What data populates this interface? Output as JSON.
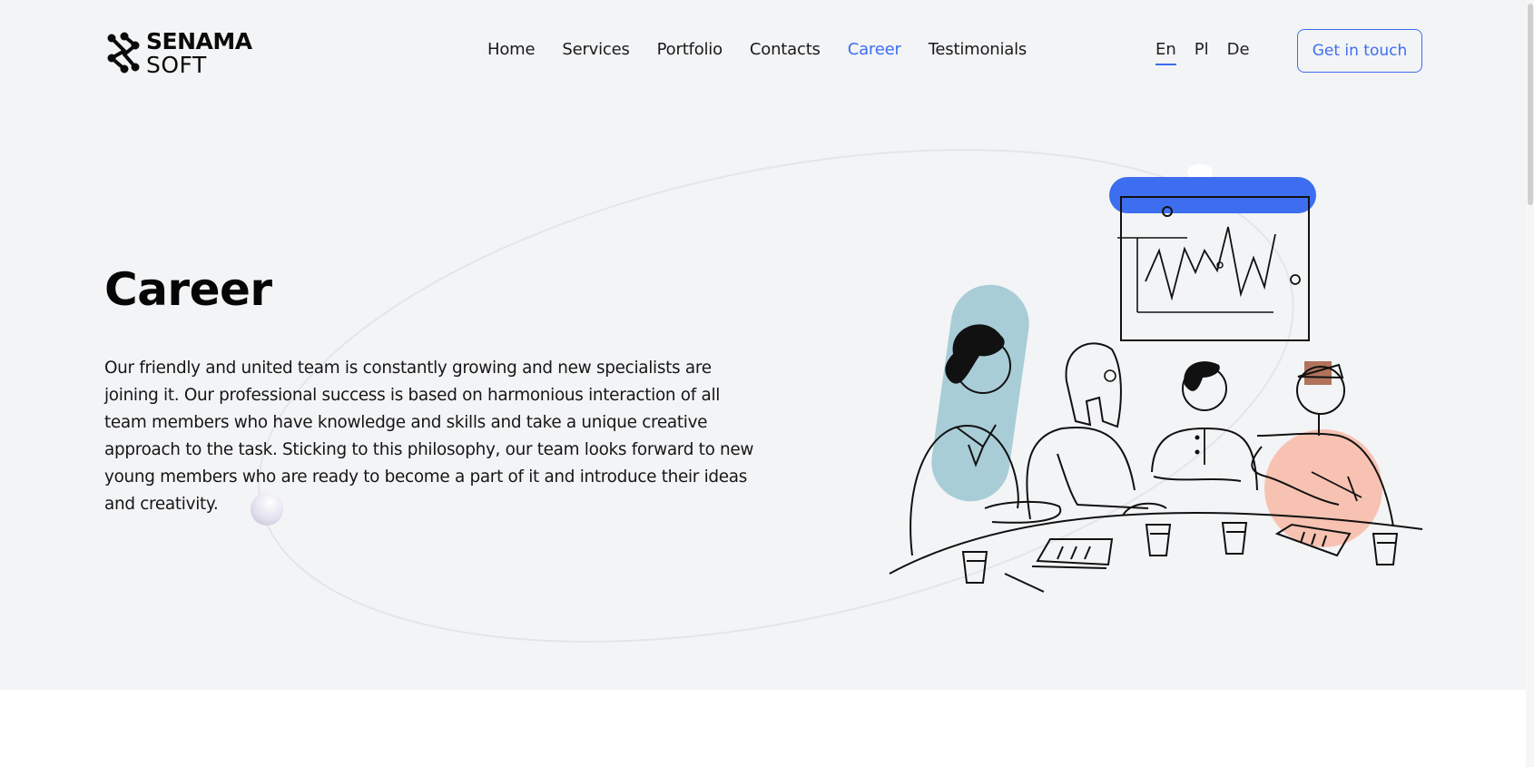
{
  "brand": {
    "name_top": "SENAMA",
    "name_bottom": "SOFT"
  },
  "nav": {
    "items": [
      {
        "label": "Home"
      },
      {
        "label": "Services"
      },
      {
        "label": "Portfolio"
      },
      {
        "label": "Contacts"
      },
      {
        "label": "Career",
        "active": true
      },
      {
        "label": "Testimonials"
      }
    ]
  },
  "languages": {
    "items": [
      {
        "label": "En",
        "selected": true
      },
      {
        "label": "Pl"
      },
      {
        "label": "De"
      }
    ]
  },
  "cta": {
    "label": "Get in touch"
  },
  "hero": {
    "title": "Career",
    "description": "Our friendly and united team is constantly growing and new specialists are joining it. Our professional success is based on harmonious interaction of all team members who have knowledge and skills and take a unique creative approach to the task. Sticking to this philosophy, our team looks forward to new young members who are ready to become a part of it and introduce their ideas and creativity."
  },
  "colors": {
    "accent": "#3d6ef0",
    "hero_bg": "#f3f4f6",
    "teal": "#a8cdd7",
    "peach": "#f7c2b2",
    "brown": "#b0735a"
  },
  "icons": {
    "logo": "senama-logo-mark",
    "illustration": "team-meeting-illustration"
  }
}
